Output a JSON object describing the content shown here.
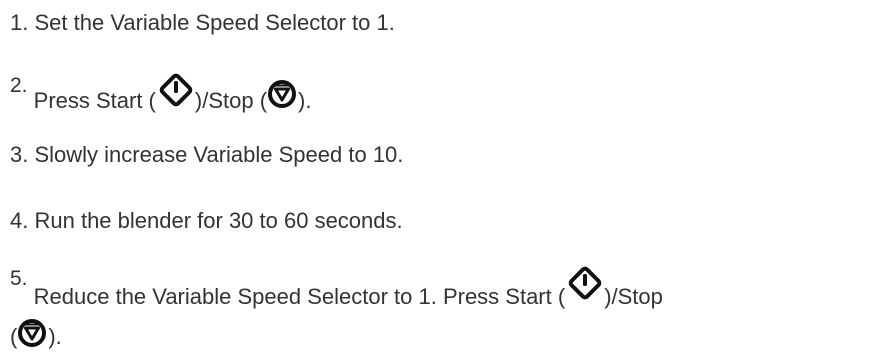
{
  "steps": [
    {
      "number": "1.",
      "text": "Set the Variable Speed Selector to 1."
    },
    {
      "number": "2.",
      "text_before_start": "Press Start (",
      "text_between": ")/Stop (",
      "text_after_stop": ")."
    },
    {
      "number": "3.",
      "text": "Slowly increase Variable Speed to 10."
    },
    {
      "number": "4.",
      "text": "Run the blender for 30 to 60 seconds."
    },
    {
      "number": "5.",
      "text_before_start": "Reduce the Variable Speed Selector to 1. Press Start (",
      "text_between": ")/Stop",
      "text_line2_before_stop": "(",
      "text_after_stop": ")."
    }
  ],
  "icons": {
    "start": "start-icon",
    "stop": "stop-icon"
  },
  "colors": {
    "text": "#333333",
    "icon": "#111111"
  }
}
